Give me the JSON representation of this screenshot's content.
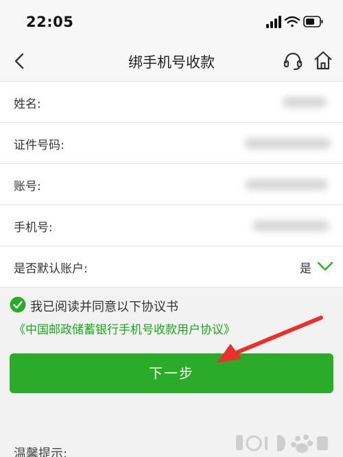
{
  "status_bar": {
    "time": "22:05"
  },
  "nav": {
    "title": "绑手机号收款",
    "back_icon": "chevron-left-icon",
    "support_icon": "headset-icon",
    "home_icon": "home-icon"
  },
  "form": {
    "fields": [
      {
        "label": "姓名:"
      },
      {
        "label": "证件号码:"
      },
      {
        "label": "账号:"
      },
      {
        "label": "手机号:"
      },
      {
        "label": "是否默认账户:",
        "value": "是"
      }
    ]
  },
  "agreement": {
    "checked": true,
    "text": "我已阅读并同意以下协议书",
    "link": "《中国邮政储蓄银行手机号收款用户协议》"
  },
  "next_button": {
    "label": "下一步"
  },
  "tip": {
    "title": "温馨提示:"
  },
  "colors": {
    "accent": "#2aab2a",
    "link": "#1aa71a",
    "annotation_arrow": "#e8312a"
  }
}
